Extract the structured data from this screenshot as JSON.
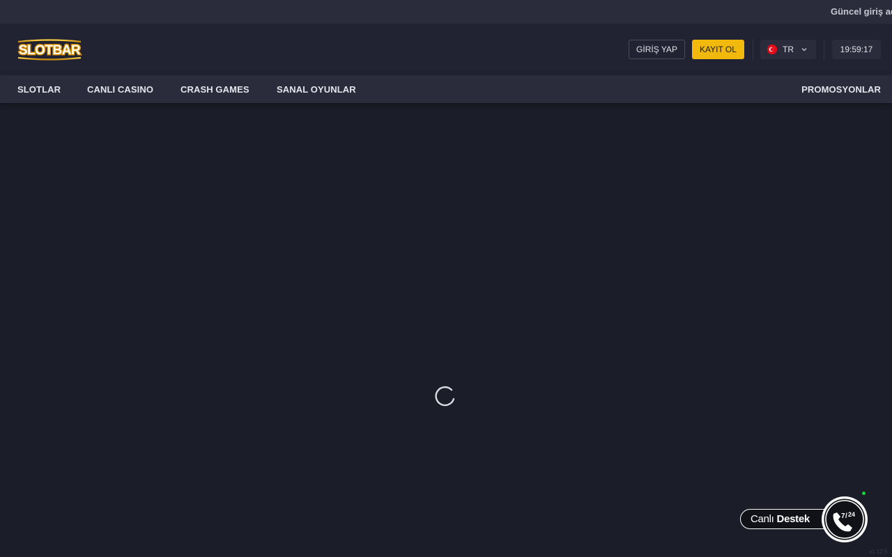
{
  "ticker": {
    "text": "Güncel giriş ad"
  },
  "header": {
    "logo_text": "SLOTBAR",
    "login_label": "GİRİŞ YAP",
    "register_label": "KAYIT OL",
    "language": "TR",
    "time": "19:59:17"
  },
  "nav": {
    "items": [
      {
        "label": "SLOTLAR"
      },
      {
        "label": "CANLI CASINO"
      },
      {
        "label": "CRASH GAMES"
      },
      {
        "label": "SANAL OYUNLAR"
      }
    ],
    "promotions_label": "PROMOSYONLAR"
  },
  "support": {
    "label_light": "Canlı",
    "label_bold": "Destek",
    "badge_top": "7",
    "badge_bottom": "24"
  },
  "version": "v1.12.5",
  "colors": {
    "background": "#1b1d29",
    "header": "#222332",
    "navbar": "#2b2c3b",
    "accent": "#f0b90b",
    "online": "#16d23a"
  }
}
